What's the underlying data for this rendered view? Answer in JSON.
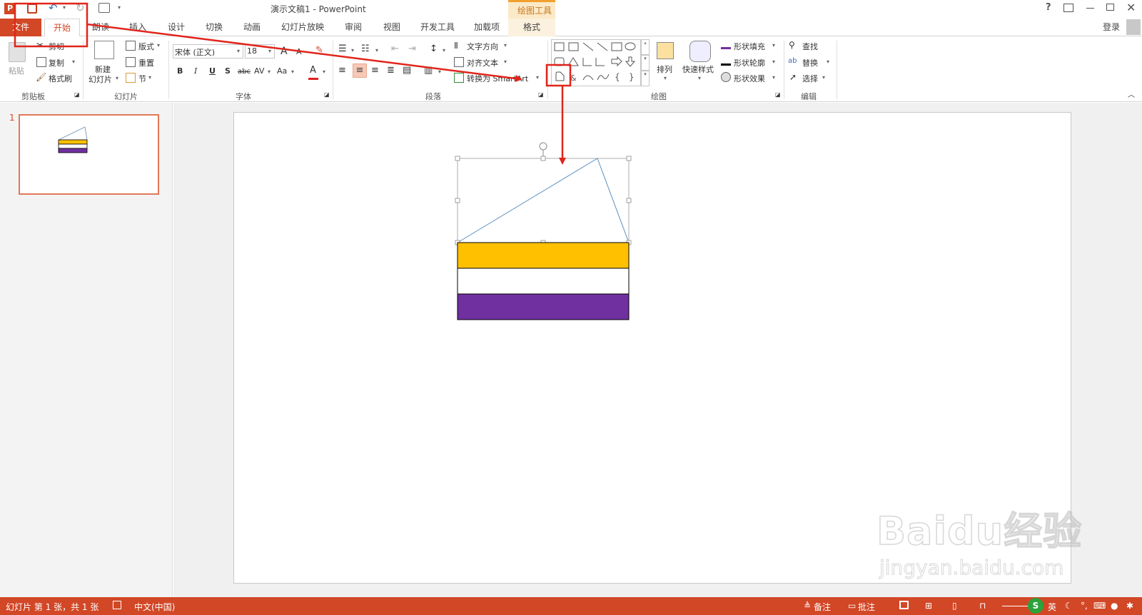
{
  "window": {
    "title": "演示文稿1 - PowerPoint",
    "contextual_group": "绘图工具",
    "help": "?",
    "login": "登录"
  },
  "tabs": [
    {
      "label": "文件"
    },
    {
      "label": "开始"
    },
    {
      "label": "朗读"
    },
    {
      "label": "插入"
    },
    {
      "label": "设计"
    },
    {
      "label": "切换"
    },
    {
      "label": "动画"
    },
    {
      "label": "幻灯片放映"
    },
    {
      "label": "审阅"
    },
    {
      "label": "视图"
    },
    {
      "label": "开发工具"
    },
    {
      "label": "加载项"
    },
    {
      "label": "格式"
    }
  ],
  "ribbon": {
    "clipboard": {
      "paste": "粘贴",
      "cut": "剪切",
      "copy": "复制",
      "format_painter": "格式刷",
      "label": "剪贴板"
    },
    "slides": {
      "new_slide_line1": "新建",
      "new_slide_line2": "幻灯片",
      "layout": "版式",
      "reset": "重置",
      "section": "节",
      "label": "幻灯片"
    },
    "font": {
      "family": "宋体 (正文)",
      "size": "18",
      "bold": "B",
      "italic": "I",
      "underline": "U",
      "shadow": "S",
      "strike": "abc",
      "spacing": "AV",
      "case": "Aa",
      "color": "A",
      "grow": "A",
      "shrink": "A",
      "label": "字体"
    },
    "paragraph": {
      "text_direction": "文字方向",
      "align_text": "对齐文本",
      "smartart": "转换为 SmartArt",
      "label": "段落"
    },
    "drawing": {
      "arrange": "排列",
      "quick_styles": "快速样式",
      "shape_fill": "形状填充",
      "shape_outline": "形状轮廓",
      "shape_effects": "形状效果",
      "label": "绘图"
    },
    "editing": {
      "find": "查找",
      "replace": "替换",
      "select": "选择",
      "label": "编辑"
    }
  },
  "thumbnail": {
    "number": "1"
  },
  "slide": {
    "stripe_colors": [
      "#ffc000",
      "#ffffff",
      "#7030a0"
    ]
  },
  "status": {
    "slide_info": "幻灯片 第 1 张，共 1 张",
    "language": "中文(中国)",
    "notes": "备注",
    "comments": "批注",
    "ime": "英"
  },
  "watermark": {
    "text": "Baidu经验",
    "url": "jingyan.baidu.com"
  },
  "colors": {
    "accent": "#d24726",
    "highlight_box": "#e0251b",
    "yellow": "#ffc000",
    "purple": "#7030a0"
  }
}
